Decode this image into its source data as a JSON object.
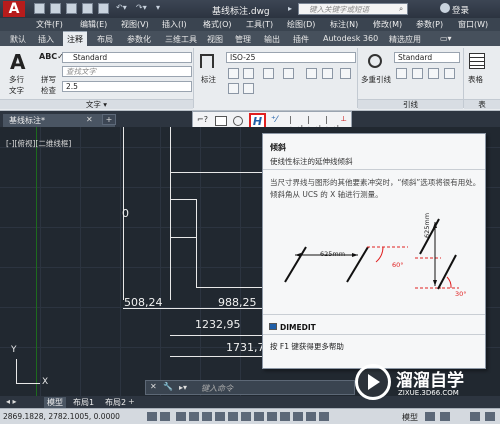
{
  "titlebar": {
    "logo": "A",
    "document_title": "基线标注.dwg",
    "search_placeholder": "键入关键字或短语",
    "login": "登录"
  },
  "menu": [
    "文件(F)",
    "编辑(E)",
    "视图(V)",
    "插入(I)",
    "格式(O)",
    "工具(T)",
    "绘图(D)",
    "标注(N)",
    "修改(M)",
    "参数(P)",
    "窗口(W)"
  ],
  "ribbon_tabs": [
    {
      "label": "默认",
      "active": false
    },
    {
      "label": "插入",
      "active": false
    },
    {
      "label": "注释",
      "active": true
    },
    {
      "label": "布局",
      "active": false
    },
    {
      "label": "参数化",
      "active": false
    },
    {
      "label": "三维工具",
      "active": false
    },
    {
      "label": "视图",
      "active": false
    },
    {
      "label": "管理",
      "active": false
    },
    {
      "label": "输出",
      "active": false
    },
    {
      "label": "插件",
      "active": false
    },
    {
      "label": "Autodesk 360",
      "active": false
    },
    {
      "label": "精选应用",
      "active": false
    }
  ],
  "ribbon": {
    "text_panel": {
      "multiline_text": "多行",
      "multiline_text2": "文字",
      "spell_check": "拼写",
      "spell_check2": "检查",
      "style_value": "Standard",
      "find_placeholder": "查找文字",
      "height_value": "2.5",
      "panel_title": "文字"
    },
    "dim_panel": {
      "dimension": "标注",
      "style_value": "ISO-25"
    },
    "leader_panel": {
      "multileader": "多重引线",
      "style_value": "Standard",
      "panel_title": "引线"
    },
    "table_panel": {
      "table": "表格",
      "panel_title": "表"
    }
  },
  "document_tab": "基线标注*",
  "viewport_label": "[-][俯视][二维线框]",
  "canvas": {
    "dims": [
      "508,24",
      "988,25",
      "1232,95",
      "1731,7"
    ],
    "zero_label": "0",
    "ucs_y": "Y",
    "ucs_x": "X"
  },
  "tooltip": {
    "title": "倾斜",
    "description": "使线性标注的延伸线倾斜",
    "body": "当尺寸界线与图形的其他要素冲突时，“倾斜”选项将很有用处。倾斜角从 UCS 的 X 轴进行测量。",
    "dim_625_a": "625mm",
    "dim_625_b": "625mm",
    "angle_60": "60°",
    "angle_30": "30°",
    "command": "DIMEDIT",
    "help": "按 F1 键获得更多帮助"
  },
  "cmdline_placeholder": "键入命令",
  "layout_tabs": [
    {
      "label": "模型",
      "active": true
    },
    {
      "label": "布局1",
      "active": false
    },
    {
      "label": "布局2",
      "active": false
    }
  ],
  "status": {
    "coords": "2869.1828,  2782.1005,  0.0000",
    "model": "模型"
  },
  "watermark": {
    "brand": "溜溜自学",
    "url": "ZIXUE.3D66.COM"
  }
}
